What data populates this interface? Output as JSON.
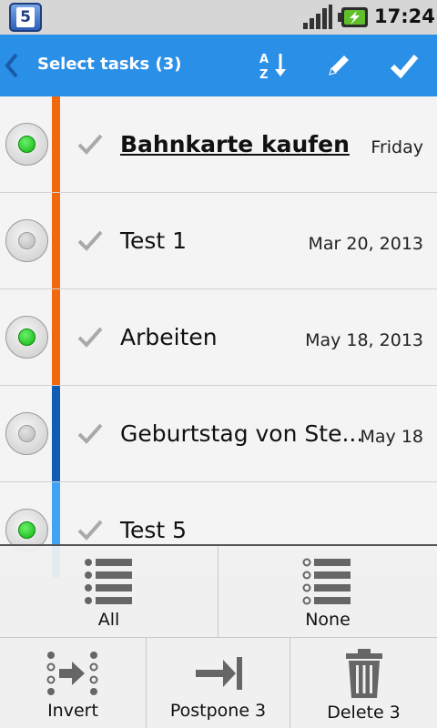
{
  "status": {
    "app_badge": "5",
    "time": "17:24"
  },
  "actionbar": {
    "title": "Select tasks (3)"
  },
  "tasks": [
    {
      "title": "Bahnkarte kaufen",
      "date": "Friday",
      "selected": true,
      "bold": true,
      "priority_color": "#f2680d"
    },
    {
      "title": "Test 1",
      "date": "Mar 20, 2013",
      "selected": false,
      "bold": false,
      "priority_color": "#f2680d"
    },
    {
      "title": "Arbeiten",
      "date": "May 18, 2013",
      "selected": true,
      "bold": false,
      "priority_color": "#f2680d"
    },
    {
      "title": "Geburtstag von Ste...",
      "date": "May 18",
      "selected": false,
      "bold": false,
      "priority_color": "#0f5bb5"
    },
    {
      "title": "Test 5",
      "date": "",
      "selected": true,
      "bold": false,
      "priority_color": "#3ea4f5"
    }
  ],
  "bottom_panel": {
    "all_label": "All",
    "none_label": "None",
    "invert_label": "Invert",
    "postpone_label": "Postpone 3",
    "delete_label": "Delete 3"
  },
  "colors": {
    "actionbar": "#2a8fe6",
    "selected_green": "#10b410"
  }
}
